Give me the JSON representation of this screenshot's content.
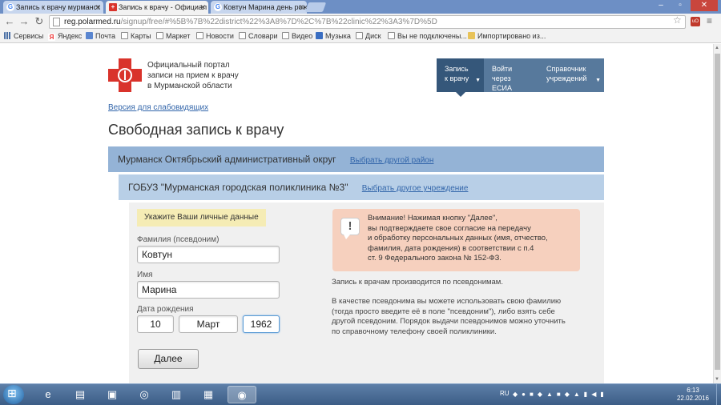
{
  "browser": {
    "tabs": [
      {
        "title": "Запись к врачу мурманск",
        "favicon": "google-icon"
      },
      {
        "title": "Запись к врачу - Официал",
        "favicon": "red-cross-icon"
      },
      {
        "title": "Ковтун Марина день рож",
        "favicon": "google-icon"
      }
    ],
    "close_glyph": "✕",
    "url_host": "reg.polarmed.ru",
    "url_path": "/signup/free/#%5B%7B%22district%22%3A8%7D%2C%7B%22clinic%22%3A3%7D%5D",
    "bookmarks": [
      {
        "label": "Сервисы",
        "icon": "apps"
      },
      {
        "label": "Яндекс",
        "icon": "ya"
      },
      {
        "label": "Почта",
        "icon": "mail"
      },
      {
        "label": "Карты",
        "icon": "doc"
      },
      {
        "label": "Маркет",
        "icon": "doc"
      },
      {
        "label": "Новости",
        "icon": "doc"
      },
      {
        "label": "Словари",
        "icon": "doc"
      },
      {
        "label": "Видео",
        "icon": "doc"
      },
      {
        "label": "Музыка",
        "icon": "music"
      },
      {
        "label": "Диск",
        "icon": "doc"
      },
      {
        "label": "Вы не подключены...",
        "icon": "doc"
      },
      {
        "label": "Импортировано из...",
        "icon": "folder"
      }
    ]
  },
  "header": {
    "portal_title_lines": [
      "Официальный портал",
      "записи на прием к врачу",
      "в Мурманской области"
    ],
    "nav": [
      {
        "line1": "Запись",
        "line2": "к врачу",
        "active": true
      },
      {
        "line1": "Войти через",
        "line2": "ЕСИА",
        "active": false
      },
      {
        "line1": "Справочник",
        "line2": "учреждений",
        "active": false
      }
    ],
    "accessibility_link": "Версия для слабовидящих"
  },
  "page_title": "Свободная запись к врачу",
  "district": {
    "name": "Мурманск Октябрьский административный округ",
    "change_link": "Выбрать другой район"
  },
  "clinic": {
    "name": "ГОБУЗ \"Мурманская городская поликлиника №3\"",
    "change_link": "Выбрать другое учреждение"
  },
  "form": {
    "hint": "Укажите Ваши личные данные",
    "surname_label": "Фамилия (псевдоним)",
    "surname_value": "Ковтун",
    "name_label": "Имя",
    "name_value": "Марина",
    "birth_label": "Дата рождения",
    "birth_day": "10",
    "birth_month": "Март",
    "birth_year": "1962",
    "next_button": "Далее"
  },
  "warning": {
    "lines": [
      "Внимание! Нажимая кнопку \"Далее\",",
      "вы подтверждаете свое согласие на передачу",
      "и обработку персональных данных (имя, отчество,",
      "фамилия, дата рождения) в соответствии с п.4",
      "ст. 9 Федерального закона № 152-ФЗ."
    ]
  },
  "notes": {
    "pseudonym": "Запись к врачам производится по псевдонимам.",
    "details_lines": [
      "В качестве псевдонима вы можете использовать свою фамилию",
      "(тогда просто введите её в поле \"псевдоним\"), либо взять себе",
      "другой псевдоним. Порядок выдачи псевдонимов можно уточнить",
      "по справочному телефону своей поликлиники."
    ]
  },
  "taskbar": {
    "lang": "RU",
    "time": "6:13",
    "date": "22.02.2016"
  },
  "colors": {
    "accent": "#35577a",
    "district_bar": "#94b3d6",
    "clinic_bar": "#b8cfe7",
    "warning_bg": "#f6d0be",
    "hint_bg": "#f5ecb5",
    "logo_red": "#d9332b"
  }
}
